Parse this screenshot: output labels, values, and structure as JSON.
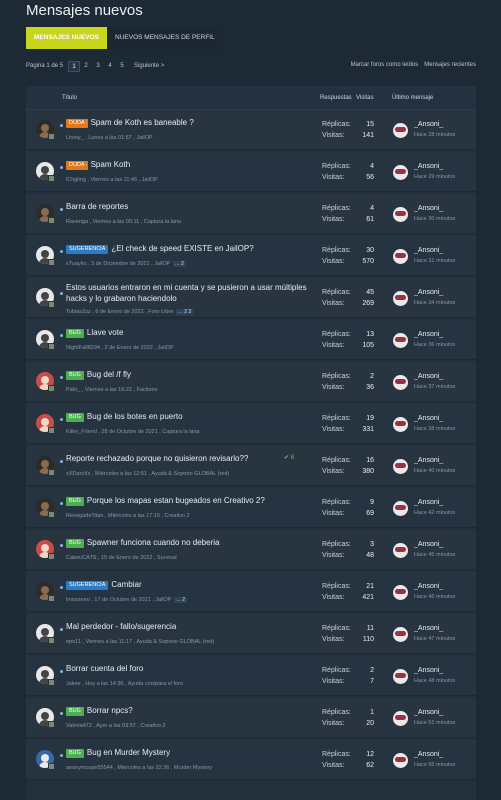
{
  "page_title": "Mensajes nuevos",
  "tabs": [
    "MENSAJES NUEVOS",
    "NUEVOS MENSAJES DE PERFIL"
  ],
  "pager": {
    "label": "Página 1 de 5",
    "pages": [
      "1",
      "2",
      "3",
      "4",
      "5"
    ],
    "next": "Siguiente >"
  },
  "top_links": [
    "Marcar foros como leídos",
    "Mensajes recientes"
  ],
  "columns": {
    "title": "Título",
    "replies": "Respuestas",
    "views": "Visitas",
    "last": "Último mensaje"
  },
  "labels": {
    "replies": "Réplicas:",
    "views": "Visitas:"
  },
  "threads": [
    {
      "prefix": "DUDA",
      "ptype": "duda",
      "title": "Spam de Koth es baneable ?",
      "meta": "Linety_ , Lunes a las 01:57 , JailOP",
      "pages": "",
      "replies": "15",
      "views": "141",
      "last_user": "_Ansoni_",
      "last_time": "Hace 28 minutos",
      "av": "dark"
    },
    {
      "prefix": "DUDA",
      "ptype": "duda",
      "title": "Spam Koth",
      "meta": "lChgling , Viernes a las 11:46 , JailOP",
      "pages": "",
      "replies": "4",
      "views": "56",
      "last_user": "_Ansoni_",
      "last_time": "Hace 29 minutos",
      "av": "light"
    },
    {
      "prefix": "",
      "ptype": "",
      "title": "Barra de reportes",
      "meta": "Ravenga , Viernes a las 00:11 , Captura la lana",
      "pages": "",
      "replies": "4",
      "views": "61",
      "last_user": "_Ansoni_",
      "last_time": "Hace 30 minutos",
      "av": "dark"
    },
    {
      "prefix": "SUGERENCIA",
      "ptype": "sug",
      "title": "¿El check de speed EXISTE en JailOP?",
      "meta": "sTuayko , 3 de Diciembre de 2021 , JailOP",
      "pages": "… 2",
      "replies": "30",
      "views": "570",
      "last_user": "_Ansoni_",
      "last_time": "Hace 31 minutos",
      "av": "light"
    },
    {
      "prefix": "",
      "ptype": "",
      "title": "Estos usuarios entraron en mi cuenta y se pusieron a usar múltiples hacks y lo grabaron haciendolo",
      "meta": "TobiasZzz , 6 de Enero de 2022 , Foro Libre",
      "pages": "… 2 3",
      "replies": "45",
      "views": "269",
      "last_user": "_Ansoni_",
      "last_time": "Hace 34 minutos",
      "av": "light",
      "two": true
    },
    {
      "prefix": "BUG",
      "ptype": "bug",
      "title": "Llave vote",
      "meta": "NightFall8294 , 2 de Enero de 2022 , JailOP",
      "pages": "",
      "replies": "13",
      "views": "105",
      "last_user": "_Ansoni_",
      "last_time": "Hace 36 minutos",
      "av": "light"
    },
    {
      "prefix": "BUG",
      "ptype": "bug",
      "title": "Bug del /f fly",
      "meta": "Pato_ , Viernes a las 16:22 , Factions",
      "pages": "",
      "replies": "2",
      "views": "36",
      "last_user": "_Ansoni_",
      "last_time": "Hace 37 minutos",
      "av": "red"
    },
    {
      "prefix": "BUG",
      "ptype": "bug",
      "title": "Bug de los botes en puerto",
      "meta": "Killer_Friend , 28 de Octubre de 2021 , Captura la lana",
      "pages": "",
      "replies": "19",
      "views": "331",
      "last_user": "_Ansoni_",
      "last_time": "Hace 38 minutos",
      "av": "red"
    },
    {
      "prefix": "",
      "ptype": "",
      "title": "Reporte rechazado porque no quisieron revisarlo??",
      "meta": "xXDarzXx , Miércoles a las 12:51 , Ayuda & Soporte GLOBAL (red)",
      "pages": "",
      "replies": "16",
      "views": "380",
      "last_user": "_Ansoni_",
      "last_time": "Hace 40 minutos",
      "av": "dark",
      "check": "✔ 8"
    },
    {
      "prefix": "BUG",
      "ptype": "bug",
      "title": "Porque los mapas estan bugeados en Creativo 2?",
      "meta": "RenegadeTitan , Miércoles a las 17:15 , Creativo 2",
      "pages": "",
      "replies": "9",
      "views": "69",
      "last_user": "_Ansoni_",
      "last_time": "Hace 42 minutos",
      "av": "dark"
    },
    {
      "prefix": "BUG",
      "ptype": "bug",
      "title": "Spawner funciona cuando no deberia",
      "meta": "CabeuCATS , 15 de Enero de 2022 , Survival",
      "pages": "",
      "replies": "3",
      "views": "48",
      "last_user": "_Ansoni_",
      "last_time": "Hace 45 minutos",
      "av": "red"
    },
    {
      "prefix": "SUGERENCIA",
      "ptype": "sug",
      "title": "Cambiar",
      "meta": "lmoozeeo , 17 de Octubre de 2021 , JailOP",
      "pages": "… 2",
      "replies": "21",
      "views": "421",
      "last_user": "_Ansoni_",
      "last_time": "Hace 46 minutos",
      "av": "dark"
    },
    {
      "prefix": "",
      "ptype": "",
      "title": "Mal perdedor - fallo/sugerencia",
      "meta": "epo11 , Viernes a las 11:17 , Ayuda & Soporte GLOBAL (red)",
      "pages": "",
      "replies": "11",
      "views": "110",
      "last_user": "_Ansoni_",
      "last_time": "Hace 47 minutos",
      "av": "light"
    },
    {
      "prefix": "",
      "ptype": "",
      "title": "Borrar cuenta del foro",
      "meta": "Jakee , Hoy a las 14:36 , Ayuda con/para el foro",
      "pages": "",
      "replies": "2",
      "views": "7",
      "last_user": "_Ansoni_",
      "last_time": "Hace 48 minutos",
      "av": "light"
    },
    {
      "prefix": "BUG",
      "ptype": "bug",
      "title": "Borrar npcs?",
      "meta": "Valeria472 , Ayer a las 03:57 , Creativo 2",
      "pages": "",
      "replies": "1",
      "views": "20",
      "last_user": "_Ansoni_",
      "last_time": "Hace 51 minutos",
      "av": "light"
    },
    {
      "prefix": "BUG",
      "ptype": "bug",
      "title": "Bug en Murder Mystery",
      "meta": "anonymouse55544 , Miércoles a las 22:36 , Murder Mystery",
      "pages": "",
      "replies": "12",
      "views": "62",
      "last_user": "_Ansoni_",
      "last_time": "Hace 55 minutos",
      "av": "blue"
    }
  ]
}
